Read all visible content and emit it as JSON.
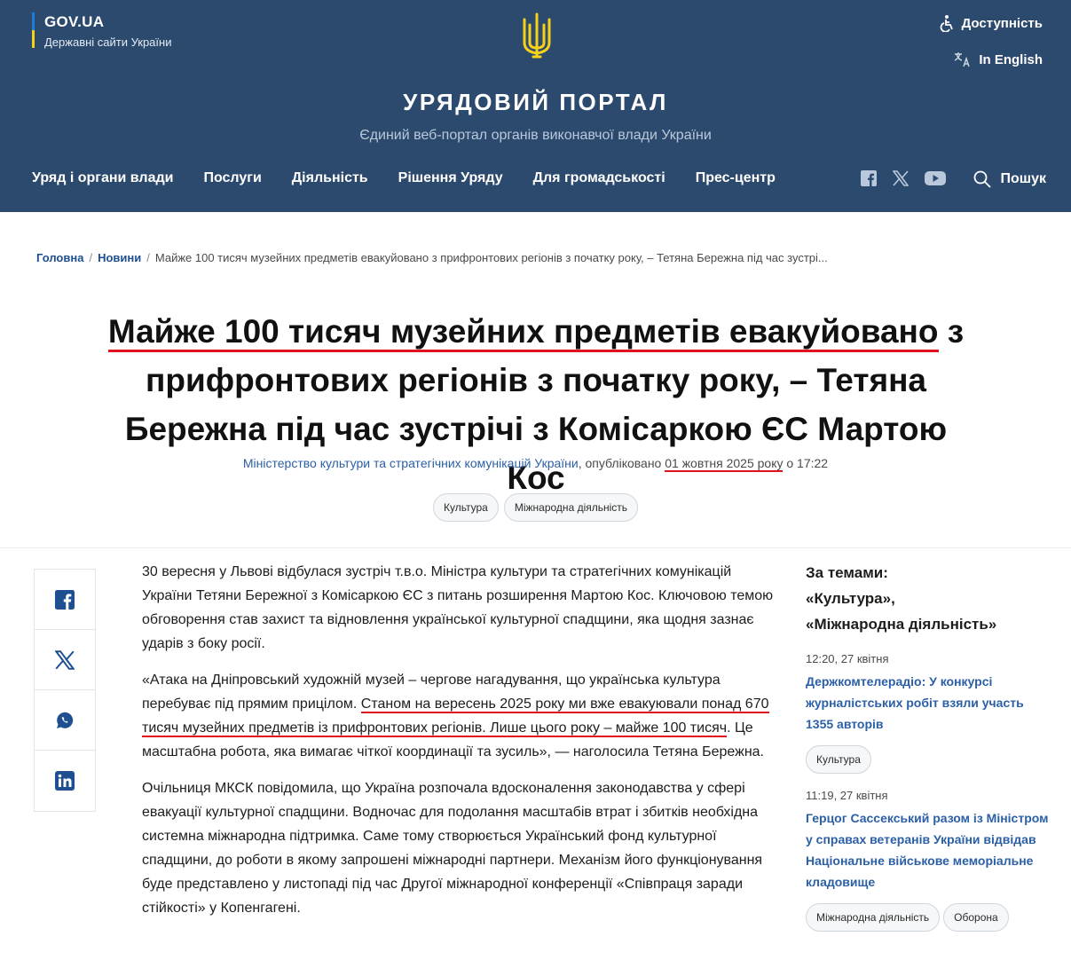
{
  "header": {
    "govua_title": "GOV.UA",
    "govua_subtitle": "Державні сайти України",
    "accessibility": "Доступність",
    "language": "In English",
    "portal_title": "УРЯДОВИЙ ПОРТАЛ",
    "portal_subtitle": "Єдиний веб-портал органів виконавчої влади України",
    "nav": [
      "Уряд і органи влади",
      "Послуги",
      "Діяльність",
      "Рішення Уряду",
      "Для громадськості",
      "Прес-центр"
    ],
    "search": "Пошук",
    "social_icons": [
      "facebook-icon",
      "x-icon",
      "youtube-icon"
    ]
  },
  "breadcrumb": {
    "home": "Головна",
    "news": "Новини",
    "current": "Майже 100 тисяч музейних предметів евакуйовано з прифронтових регіонів з початку року, – Тетяна Бережна під час зустрі..."
  },
  "article": {
    "title_underlined": "Майже 100 тисяч музейних предметів евакуйовано",
    "title_rest": " з прифронтових регіонів з початку року, – Тетяна Бережна під час зустрічі з Комісаркою ЄС Мартою Кос",
    "source": "Міністерство культури та стратегічних комунікацій України",
    "published_label": ", опубліковано ",
    "date": "01 жовтня 2025 року",
    "time_label": " о 17:22",
    "tags": [
      "Культура",
      "Міжнародна діяльність"
    ],
    "p1": "30 вересня у Львові відбулася зустріч т.в.о. Міністра культури та стратегічних комунікацій України Тетяни Бережної з Комісаркою ЄС з питань розширення Мартою Кос. Ключовою темою обговорення став захист та відновлення української культурної спадщини, яка щодня зазнає ударів з боку росії.",
    "p2_start": "«Атака на Дніпровський художній музей – чергове нагадування, що українська культура перебуває під прямим прицілом. ",
    "p2_highlight": "Станом на вересень 2025 року ми вже евакуювали понад 670 тисяч музейних предметів із прифронтових регіонів. Лише цього року – майже 100 тисяч",
    "p2_end": ". Це масштабна робота, яка вимагає чіткої координації та зусиль», — наголосила Тетяна Бережна.",
    "p3": "Очільниця МКСК повідомила, що Україна розпочала вдосконалення законодавства у сфері евакуації культурної спадщини. Водночас для подолання масштабів втрат і збитків необхідна системна міжнародна підтримка. Саме тому створюється Український фонд культурної спадщини, до роботи в якому запрошені міжнародні партнери. Механізм його функціонування буде представлено у листопаді під час Другої міжнародної конференції «Співпраця заради стійкості» у Копенгагені."
  },
  "share": [
    "facebook-icon",
    "x-icon",
    "whatsapp-icon",
    "linkedin-icon"
  ],
  "aside": {
    "heading_line1": "За темами:",
    "heading_line2": "«Культура»,",
    "heading_line3": "«Міжнародна діяльність»",
    "news": [
      {
        "time": "12:20, 27 квітня",
        "title": "Держкомтелерадіо: У конкурсі журналістських робіт взяли участь 1355 авторів",
        "tags": [
          "Культура"
        ]
      },
      {
        "time": "11:19, 27 квітня",
        "title": "Герцог Сассекський разом із Міністром у справах ветеранів України відвідав Національне військове меморіальне кладовище",
        "tags": [
          "Міжнародна діяльність",
          "Оборона"
        ]
      }
    ]
  }
}
